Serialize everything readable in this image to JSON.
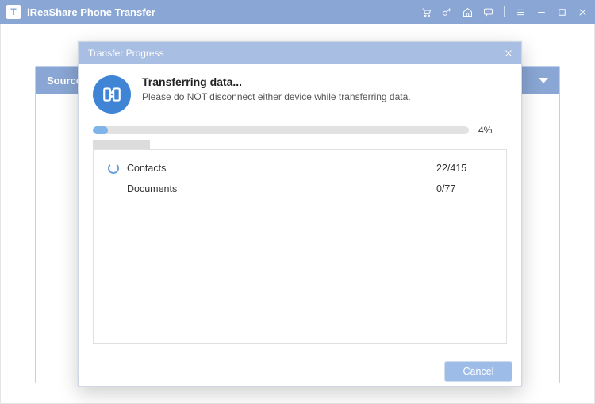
{
  "titlebar": {
    "app_name": "iReaShare Phone Transfer"
  },
  "source_panel": {
    "label": "Source:"
  },
  "modal": {
    "title": "Transfer Progress",
    "heading": "Transferring data...",
    "subtext": "Please do NOT disconnect either device while transferring data.",
    "progress_percent_label": "4%",
    "progress_value": 4,
    "items": [
      {
        "name": "Contacts",
        "count": "22/415",
        "spinning": true
      },
      {
        "name": "Documents",
        "count": "0/77",
        "spinning": false
      }
    ],
    "cancel_label": "Cancel"
  }
}
